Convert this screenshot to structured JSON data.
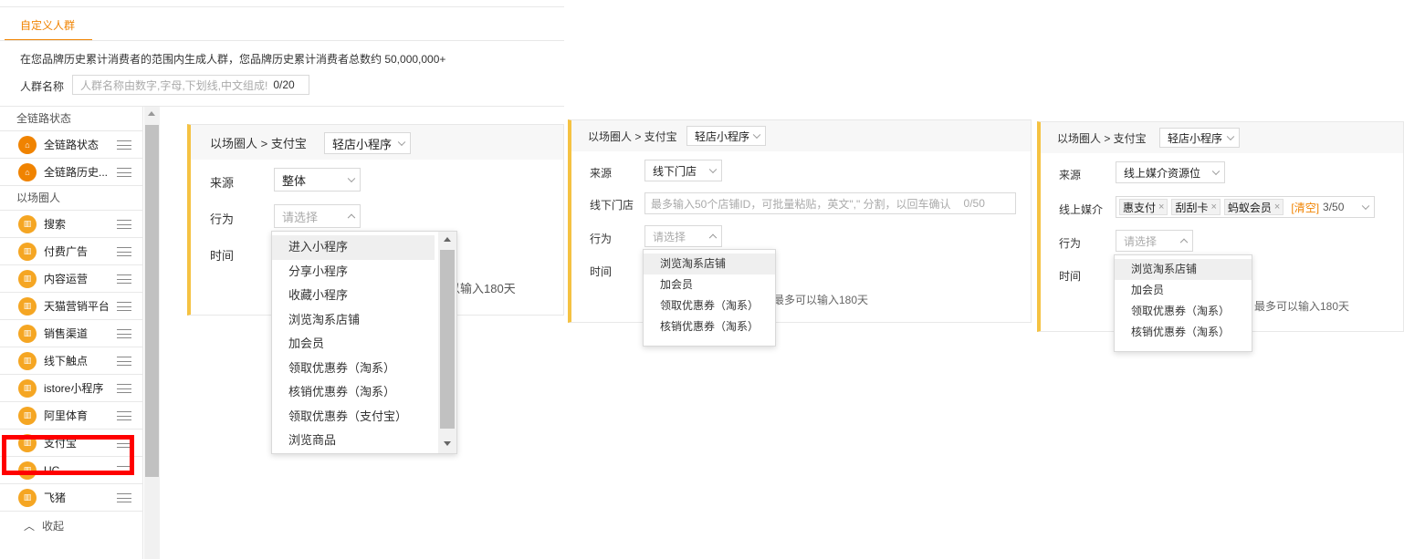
{
  "main": {
    "tab_label": "自定义人群",
    "description": "在您品牌历史累计消费者的范围内生成人群，您品牌历史累计消费者总数约 50,000,000+",
    "name_label": "人群名称",
    "name_placeholder": "人群名称由数字,字母,下划线,中文组成!",
    "name_count": "0/20"
  },
  "sidebar": {
    "group_full_chain": "全链路状态",
    "group_scene": "以场圈人",
    "items": [
      {
        "label": "全链路状态",
        "icon": "house-icon"
      },
      {
        "label": "全链路历史...",
        "icon": "house-icon"
      },
      {
        "label": "搜索",
        "icon": "building-icon"
      },
      {
        "label": "付费广告",
        "icon": "building-icon"
      },
      {
        "label": "内容运营",
        "icon": "building-icon"
      },
      {
        "label": "天猫营销平台",
        "icon": "building-icon"
      },
      {
        "label": "销售渠道",
        "icon": "building-icon"
      },
      {
        "label": "线下触点",
        "icon": "building-icon"
      },
      {
        "label": "istore小程序",
        "icon": "building-icon"
      },
      {
        "label": "阿里体育",
        "icon": "building-icon"
      },
      {
        "label": "支付宝",
        "icon": "building-icon"
      },
      {
        "label": "UC",
        "icon": "building-icon"
      },
      {
        "label": "飞猪",
        "icon": "building-icon"
      }
    ],
    "collapse_label": "收起",
    "collapse_icon": "chevron-up-icon",
    "highlight_color": "#ff0000"
  },
  "card1": {
    "crumb": "以场圈人 > 支付宝",
    "mini_select": "轻店小程序",
    "source_label": "来源",
    "source_value": "整体",
    "action_label": "行为",
    "action_placeholder": "请选择",
    "time_label": "时间",
    "time_hint": "以输入180天",
    "options": [
      "进入小程序",
      "分享小程序",
      "收藏小程序",
      "浏览淘系店铺",
      "加会员",
      "领取优惠券（淘系）",
      "核销优惠券（淘系）",
      "领取优惠券（支付宝）",
      "浏览商品"
    ]
  },
  "card2": {
    "crumb": "以场圈人 > 支付宝",
    "mini_select": "轻店小程序",
    "source_label": "来源",
    "source_value": "线下门店",
    "store_label": "线下门店",
    "store_placeholder": "最多输入50个店铺ID，可批量粘贴，英文\",\" 分割，以回车确认",
    "store_count": "0/50",
    "action_label": "行为",
    "action_placeholder": "请选择",
    "time_label": "时间",
    "time_hint": "最多可以输入180天",
    "options": [
      "浏览淘系店铺",
      "加会员",
      "领取优惠券（淘系）",
      "核销优惠券（淘系）"
    ]
  },
  "card3": {
    "crumb": "以场圈人 > 支付宝",
    "mini_select": "轻店小程序",
    "source_label": "来源",
    "source_value": "线上媒介资源位",
    "media_label": "线上媒介",
    "tags": [
      "惠支付",
      "刮刮卡",
      "蚂蚁会员"
    ],
    "clear_label": "[清空]",
    "tag_count": "3/50",
    "action_label": "行为",
    "action_placeholder": "请选择",
    "time_label": "时间",
    "time_hint": "最多可以输入180天",
    "options": [
      "浏览淘系店铺",
      "加会员",
      "领取优惠券（淘系）",
      "核销优惠券（淘系）"
    ]
  },
  "colors": {
    "accent": "#f08300",
    "card_border": "#f5c242",
    "icon_bg": "#f5a623"
  }
}
